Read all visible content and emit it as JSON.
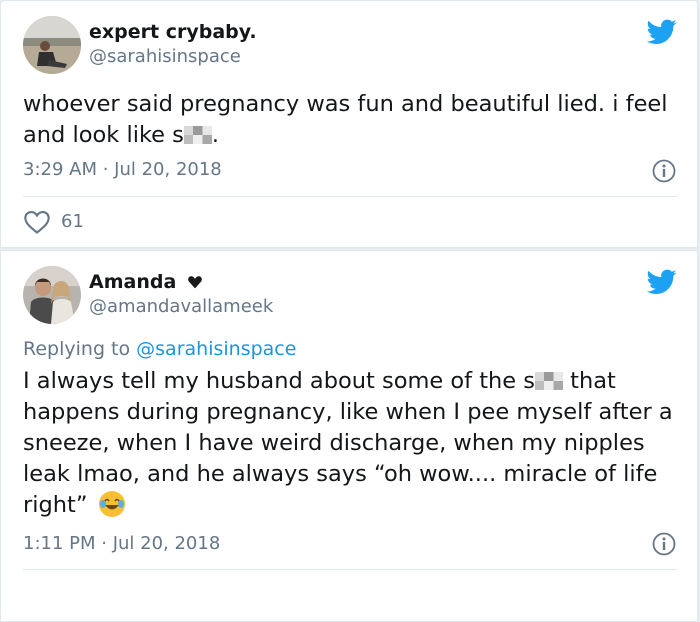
{
  "tweet1": {
    "display_name": "expert crybaby.",
    "handle": "@sarahisinspace",
    "text_part1": "whoever said pregnancy was fun and beautiful lied. i feel and look like s",
    "text_part2": ".",
    "timestamp": "3:29 AM · Jul 20, 2018",
    "likes": "61"
  },
  "tweet2": {
    "display_name": "Amanda",
    "handle": "@amandavallameek",
    "replying_prefix": "Replying to ",
    "replying_handle": "@sarahisinspace",
    "text_part1": "I always tell my husband about some of the s",
    "text_part2": " that happens during pregnancy, like when I pee myself after a sneeze, when I have weird discharge, when my nipples leak lmao, and he always says “oh wow.... miracle of life right” ",
    "timestamp": "1:11 PM · Jul 20, 2018"
  },
  "icons": {
    "bird": "twitter-bird-icon",
    "info": "info-icon",
    "heart": "heart-icon",
    "verified_heart": "black-heart-icon",
    "emoji": "tears-of-joy-emoji"
  },
  "colors": {
    "brand": "#1da1f2",
    "muted": "#657786",
    "link": "#1b95e0",
    "divider": "#e1e8ed"
  }
}
